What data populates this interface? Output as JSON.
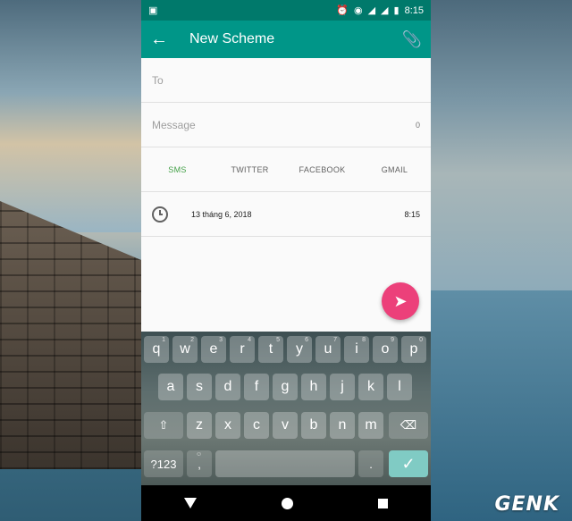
{
  "status_bar": {
    "time": "8:15"
  },
  "app_bar": {
    "title": "New Scheme"
  },
  "form": {
    "to_placeholder": "To",
    "message_placeholder": "Message",
    "char_count": "0"
  },
  "tabs": [
    {
      "label": "SMS",
      "active": true
    },
    {
      "label": "TWITTER",
      "active": false
    },
    {
      "label": "FACEBOOK",
      "active": false
    },
    {
      "label": "GMAIL",
      "active": false
    }
  ],
  "schedule": {
    "date": "13 tháng 6, 2018",
    "time": "8:15"
  },
  "colors": {
    "primary": "#009688",
    "primary_dark": "#00796b",
    "accent": "#ec407a",
    "tab_active": "#43a047"
  },
  "keyboard": {
    "row1": [
      "q",
      "w",
      "e",
      "r",
      "t",
      "y",
      "u",
      "i",
      "o",
      "p"
    ],
    "row1_hints": [
      "1",
      "2",
      "3",
      "4",
      "5",
      "6",
      "7",
      "8",
      "9",
      "0"
    ],
    "row2": [
      "a",
      "s",
      "d",
      "f",
      "g",
      "h",
      "j",
      "k",
      "l"
    ],
    "row3": [
      "z",
      "x",
      "c",
      "v",
      "b",
      "n",
      "m"
    ],
    "symbols_label": "?123",
    "comma_label": ",",
    "period_label": "."
  },
  "watermark": "GENK"
}
